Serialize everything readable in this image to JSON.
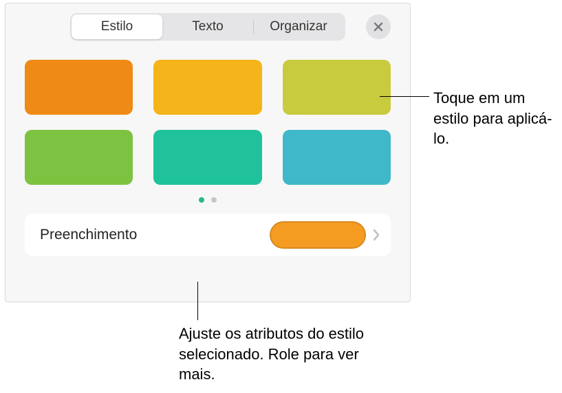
{
  "tabs": {
    "style": "Estilo",
    "text": "Texto",
    "arrange": "Organizar",
    "activeIndex": 0
  },
  "swatches": {
    "colors": [
      "#ef8a17",
      "#f4b41a",
      "#c9cb3f",
      "#7ec242",
      "#1fc29a",
      "#3fb8c9"
    ]
  },
  "pager": {
    "count": 2,
    "activeIndex": 0
  },
  "fill": {
    "label": "Preenchimento",
    "previewColor": "#f49b22",
    "borderColor": "#d88a1e"
  },
  "callouts": {
    "tapStyle": "Toque em um estilo para aplicá-lo.",
    "adjustAttrs": "Ajuste os atributos do estilo selecionado. Role para ver mais."
  }
}
